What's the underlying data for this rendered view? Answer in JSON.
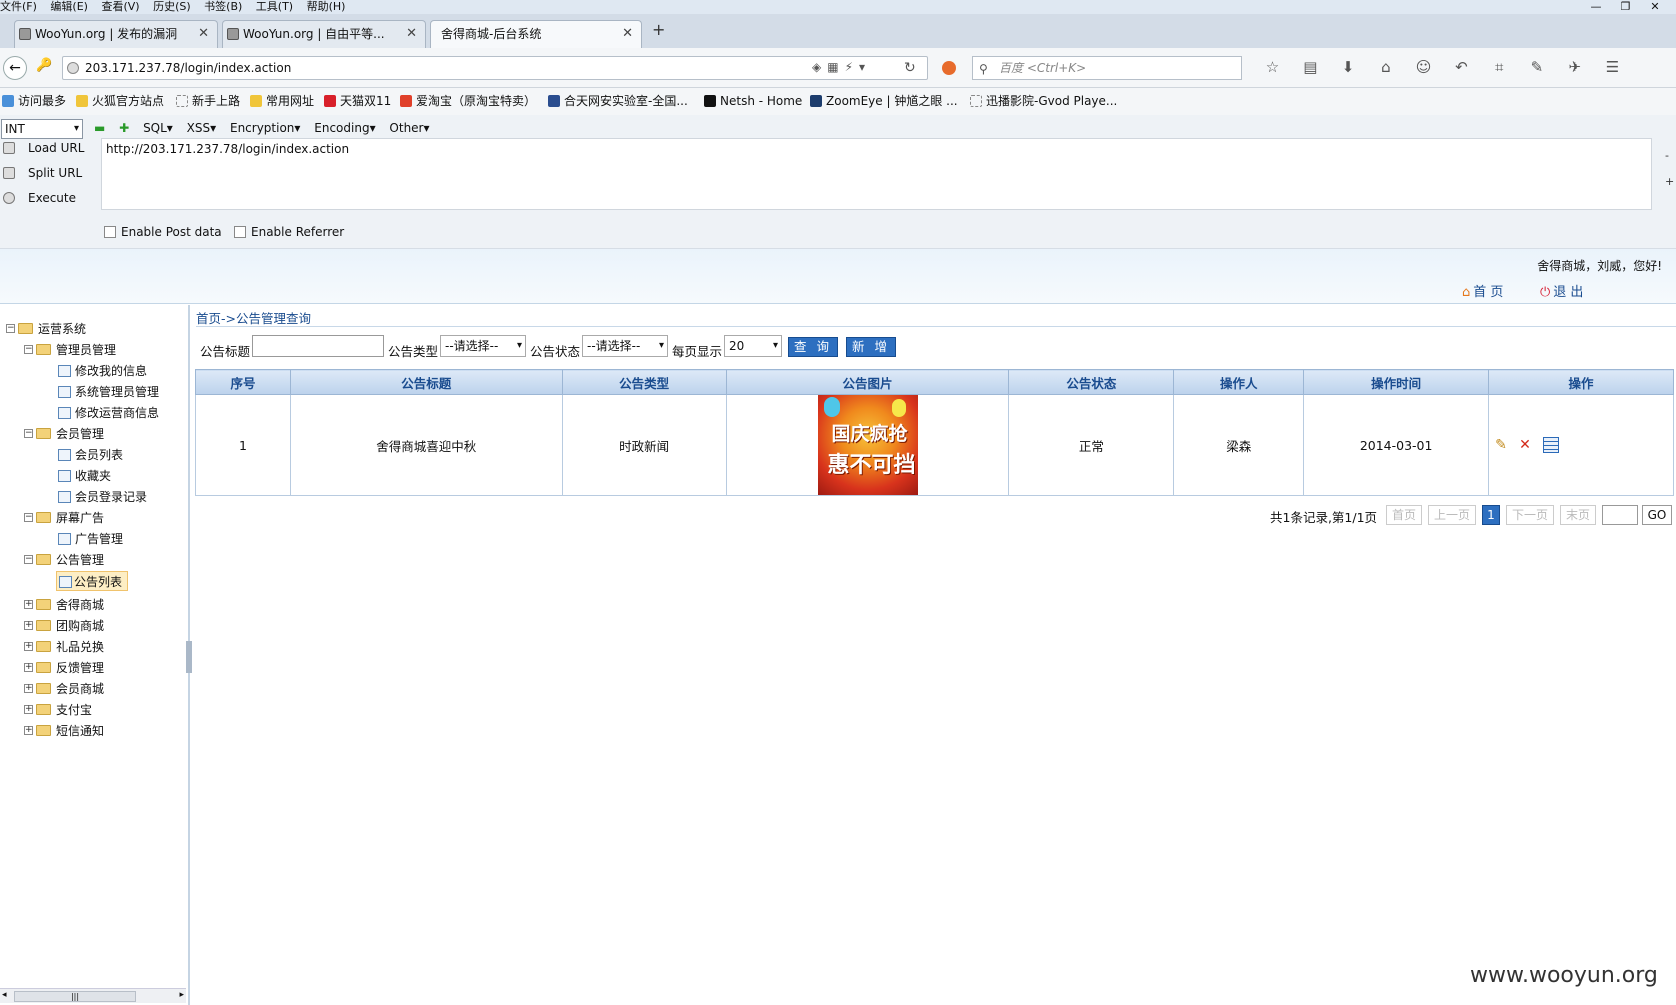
{
  "menubar": [
    "文件(F)",
    "编辑(E)",
    "查看(V)",
    "历史(S)",
    "书签(B)",
    "工具(T)",
    "帮助(H)"
  ],
  "window_controls": [
    "—",
    "❐",
    "✕"
  ],
  "tabs": [
    {
      "title": "WooYun.org | 发布的漏洞"
    },
    {
      "title": "WooYun.org | 自由平等..."
    },
    {
      "title": "舍得商城-后台系统"
    }
  ],
  "new_tab": "+",
  "address": {
    "url": "203.171.237.78/login/index.action"
  },
  "search": {
    "placeholder": "百度 <Ctrl+K>"
  },
  "bookmarks": [
    "访问最多",
    "火狐官方站点",
    "新手上路",
    "常用网址",
    "天猫双11",
    "爱淘宝（原淘宝特卖）",
    "合天网安实验室-全国...",
    "Netsh - Home",
    "ZoomEye | 钟馗之眼 ...",
    "迅播影院-Gvod Playe..."
  ],
  "hackbar": {
    "type_select": "INT",
    "menus": [
      "SQL▾",
      "XSS▾",
      "Encryption▾",
      "Encoding▾",
      "Other▾"
    ],
    "load_url": "Load URL",
    "split_url": "Split URL",
    "execute": "Execute",
    "url_text": "http://203.171.237.78/login/index.action",
    "side_minus": "-",
    "side_plus": "+",
    "enable_post": "Enable Post data",
    "enable_referrer": "Enable Referrer"
  },
  "header": {
    "greeting": "舍得商城，刘威，您好!",
    "home": "首 页",
    "logout": "退 出"
  },
  "sidebar": {
    "root": "运营系统",
    "groups": [
      {
        "label": "管理员管理",
        "expanded": true,
        "children": [
          "修改我的信息",
          "系统管理员管理",
          "修改运营商信息"
        ]
      },
      {
        "label": "会员管理",
        "expanded": true,
        "children": [
          "会员列表",
          "收藏夹",
          "会员登录记录"
        ]
      },
      {
        "label": "屏幕广告",
        "expanded": true,
        "children": [
          "广告管理"
        ]
      },
      {
        "label": "公告管理",
        "expanded": true,
        "children": [
          "公告列表"
        ]
      },
      {
        "label": "舍得商城",
        "expanded": false
      },
      {
        "label": "团购商城",
        "expanded": false
      },
      {
        "label": "礼品兑换",
        "expanded": false
      },
      {
        "label": "反馈管理",
        "expanded": false
      },
      {
        "label": "会员商城",
        "expanded": false
      },
      {
        "label": "支付宝",
        "expanded": false
      },
      {
        "label": "短信通知",
        "expanded": false
      }
    ],
    "selected": "公告列表"
  },
  "main": {
    "breadcrumb": "首页->公告管理查询",
    "filter": {
      "title_label": "公告标题",
      "title_value": "",
      "type_label": "公告类型",
      "type_value": "--请选择--",
      "status_label": "公告状态",
      "status_value": "--请选择--",
      "perpage_label": "每页显示",
      "perpage_value": "20",
      "query_btn": "查 询",
      "add_btn": "新 增"
    },
    "table": {
      "headers": [
        "序号",
        "公告标题",
        "公告类型",
        "公告图片",
        "公告状态",
        "操作人",
        "操作时间",
        "操作"
      ],
      "rows": [
        {
          "no": "1",
          "title": "舍得商城喜迎中秋",
          "type": "时政新闻",
          "image_text_1": "国庆疯抢",
          "image_text_2": "惠不可挡",
          "status": "正常",
          "operator": "梁森",
          "time": "2014-03-01"
        }
      ]
    },
    "pager": {
      "summary": "共1条记录,第1/1页",
      "first": "首页",
      "prev": "上一页",
      "current": "1",
      "next": "下一页",
      "last": "末页",
      "go": "GO"
    }
  },
  "watermark": "www.wooyun.org"
}
